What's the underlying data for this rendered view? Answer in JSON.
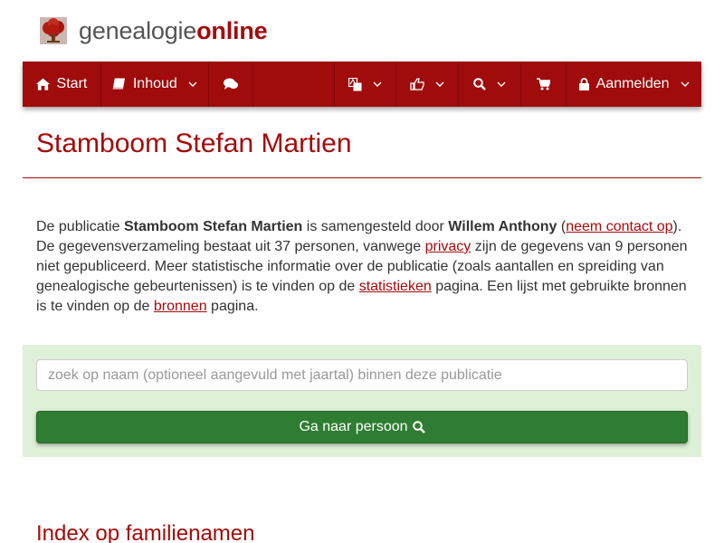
{
  "brand": {
    "name_part1": "genealogie",
    "name_part2": "online",
    "logo_icon": "tree-logo-icon",
    "brand_color": "#a50a0a"
  },
  "nav": {
    "bar_color": "#a00b0b",
    "start": {
      "label": "Start",
      "icon": "home-icon"
    },
    "inhoud": {
      "label": "Inhoud",
      "icon": "book-icon"
    },
    "comments": {
      "icon": "comments-icon"
    },
    "language": {
      "icon": "language-icon"
    },
    "like": {
      "icon": "thumbs-up-icon"
    },
    "search": {
      "icon": "search-icon"
    },
    "shop": {
      "icon": "shopping-cart-icon"
    },
    "login": {
      "label": "Aanmelden",
      "icon": "lock-icon"
    }
  },
  "page": {
    "title": "Stamboom Stefan Martien"
  },
  "intro": {
    "t1": "De publicatie ",
    "publication": "Stamboom Stefan Martien",
    "t2": " is samengesteld door ",
    "author": "Willem Anthony",
    "t3": " (",
    "contact_link": "neem contact op",
    "t4": "). De gegevensverzameling bestaat uit 37 personen, vanwege ",
    "privacy_link": "privacy",
    "t5": " zijn de gegevens van 9 personen niet gepubliceerd. Meer statistische informatie over de publicatie (zoals aantallen en spreiding van genealogische gebeurtenissen) is te vinden op de ",
    "stats_link": "statistieken",
    "t6": " pagina. Een lijst met gebruikte bronnen is te vinden op de ",
    "sources_link": "bronnen",
    "t7": " pagina."
  },
  "search": {
    "placeholder": "zoek op naam (optioneel aangevuld met jaartal) binnen deze publicatie",
    "value": "",
    "button_label": "Ga naar persoon",
    "button_icon": "search-icon",
    "panel_color": "#dff0d8",
    "button_color": "#2e7d32"
  },
  "index": {
    "heading": "Index op familienamen"
  }
}
